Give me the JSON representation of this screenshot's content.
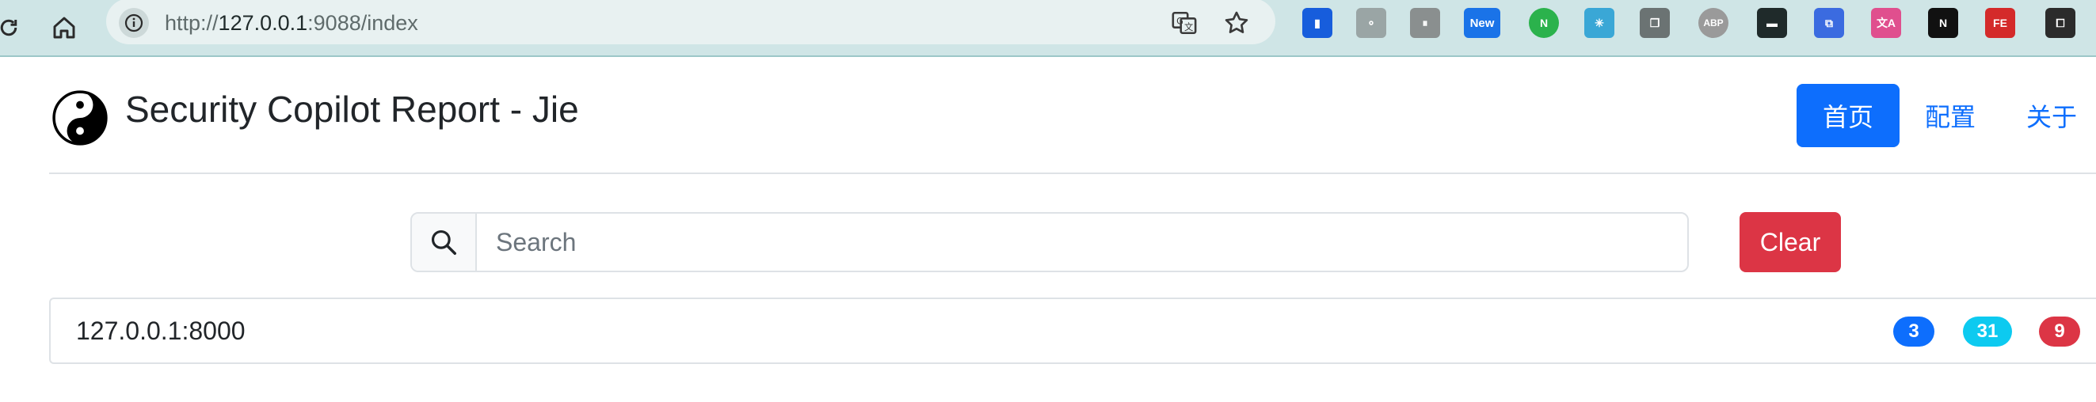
{
  "browser": {
    "url_scheme": "http://",
    "url_host": "127.0.0.1",
    "url_rest": ":9088/index",
    "extensions": [
      {
        "name": "bitwarden-icon",
        "color": "#175ddc",
        "glyph": "▮"
      },
      {
        "name": "extension-circles-icon",
        "color": "#9aa5a5",
        "glyph": "⚬"
      },
      {
        "name": "extension-paused-icon",
        "color": "#8a8f8f",
        "glyph": "⏸"
      },
      {
        "name": "new-badge-icon",
        "color": "#1a73e8",
        "glyph": "New"
      },
      {
        "name": "extension-n-icon",
        "color": "#2bb24c",
        "glyph": "N"
      },
      {
        "name": "loading-spinner-icon",
        "color": "#3aa7d6",
        "glyph": "✳"
      },
      {
        "name": "copy-icon",
        "color": "#6b7373",
        "glyph": "❐"
      },
      {
        "name": "adblock-icon",
        "color": "#9a9a9a",
        "glyph": "ABP"
      },
      {
        "name": "card-icon",
        "color": "#1f2a2a",
        "glyph": "▬"
      },
      {
        "name": "screenshot-icon",
        "color": "#3b6be0",
        "glyph": "⧉"
      },
      {
        "name": "translate-icon",
        "color": "#e04f8e",
        "glyph": "文A"
      },
      {
        "name": "notion-icon",
        "color": "#111111",
        "glyph": "N"
      },
      {
        "name": "fe-helper-icon",
        "color": "#d42a2a",
        "glyph": "FE"
      },
      {
        "name": "extensions-puzzle-icon",
        "color": "#2b2b2b",
        "glyph": "⧠"
      }
    ]
  },
  "header": {
    "title": "Security Copilot Report - Jie",
    "nav": {
      "home": "首页",
      "config": "配置",
      "about": "关于"
    }
  },
  "search": {
    "placeholder": "Search",
    "value": "",
    "clear_label": "Clear"
  },
  "list": {
    "items": [
      {
        "label": "127.0.0.1:8000",
        "badges": [
          {
            "value": "3",
            "color": "#0d6efd"
          },
          {
            "value": "31",
            "color": "#0dcaf0"
          },
          {
            "value": "9",
            "color": "#dc3545"
          }
        ]
      }
    ]
  }
}
